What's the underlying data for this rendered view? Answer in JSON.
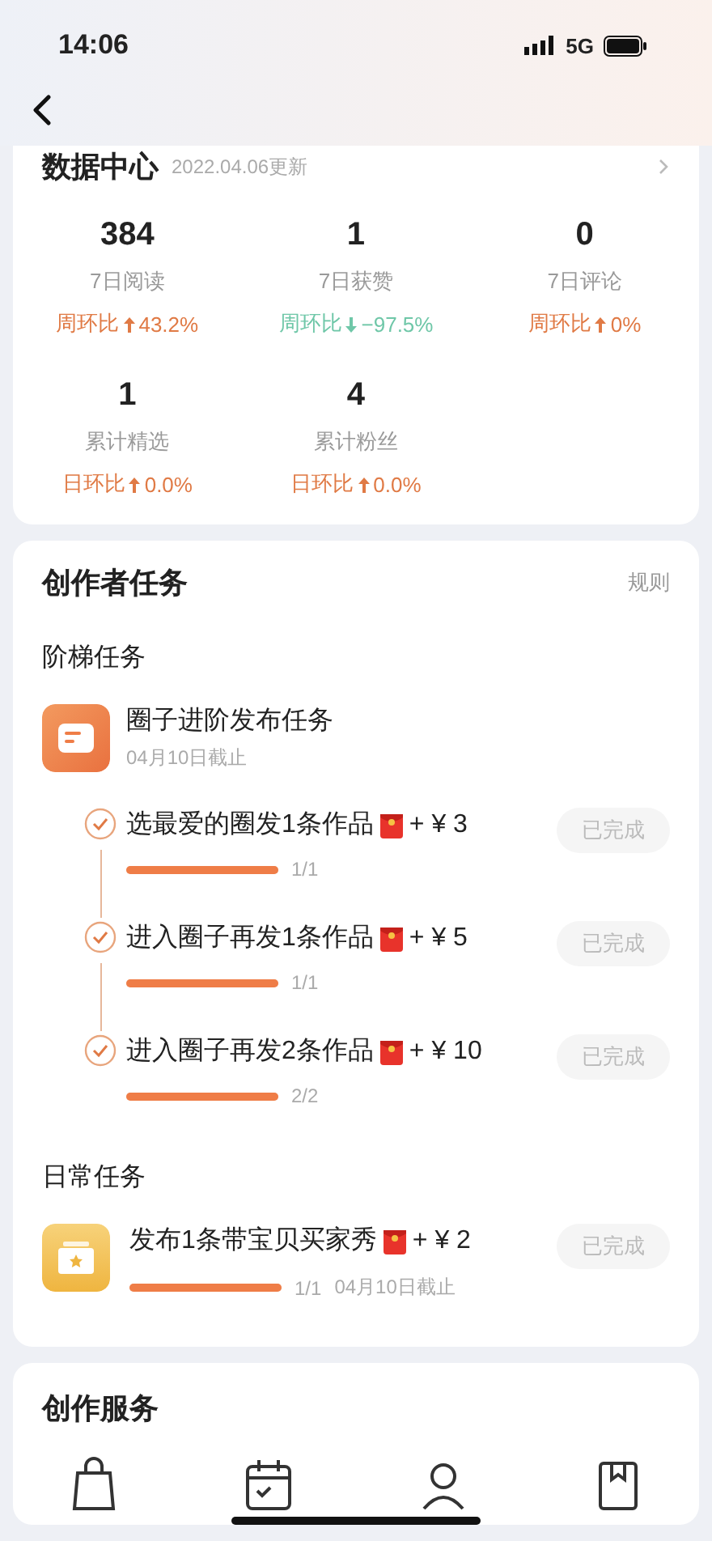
{
  "status_bar": {
    "time": "14:06",
    "network": "5G"
  },
  "data_center": {
    "title": "数据中心",
    "updated": "2022.04.06更新",
    "stats": [
      {
        "value": "384",
        "label": "7日阅读",
        "compare": "周环比",
        "kind": "up",
        "change": "43.2%"
      },
      {
        "value": "1",
        "label": "7日获赞",
        "compare": "周环比",
        "kind": "down",
        "change": "−97.5%"
      },
      {
        "value": "0",
        "label": "7日评论",
        "compare": "周环比",
        "kind": "up",
        "change": "0%"
      },
      {
        "value": "1",
        "label": "累计精选",
        "compare": "日环比",
        "kind": "up",
        "change": "0.0%"
      },
      {
        "value": "4",
        "label": "累计粉丝",
        "compare": "日环比",
        "kind": "up",
        "change": "0.0%"
      }
    ]
  },
  "creator_tasks": {
    "title": "创作者任务",
    "rules": "规则",
    "ladder": {
      "title": "阶梯任务",
      "group_title": "圈子进阶发布任务",
      "deadline": "04月10日截止",
      "steps": [
        {
          "title": "选最爱的圈发1条作品",
          "reward": "+ ¥ 3",
          "progress": "1/1",
          "level": 1,
          "checked": true,
          "status": "已完成"
        },
        {
          "title": "进入圈子再发1条作品",
          "reward": "+ ¥ 5",
          "progress": "1/1",
          "level": 1,
          "checked": true,
          "status": "已完成"
        },
        {
          "title": "进入圈子再发2条作品",
          "reward": "+ ¥ 10",
          "progress": "2/2",
          "level": 1,
          "checked": true,
          "status": "已完成"
        }
      ]
    },
    "daily": {
      "title": "日常任务",
      "items": [
        {
          "title": "发布1条带宝贝买家秀",
          "reward": "+ ¥ 2",
          "progress": "1/1",
          "deadline": "04月10日截止",
          "level": 1,
          "status": "已完成"
        }
      ]
    }
  },
  "services": {
    "title": "创作服务"
  }
}
